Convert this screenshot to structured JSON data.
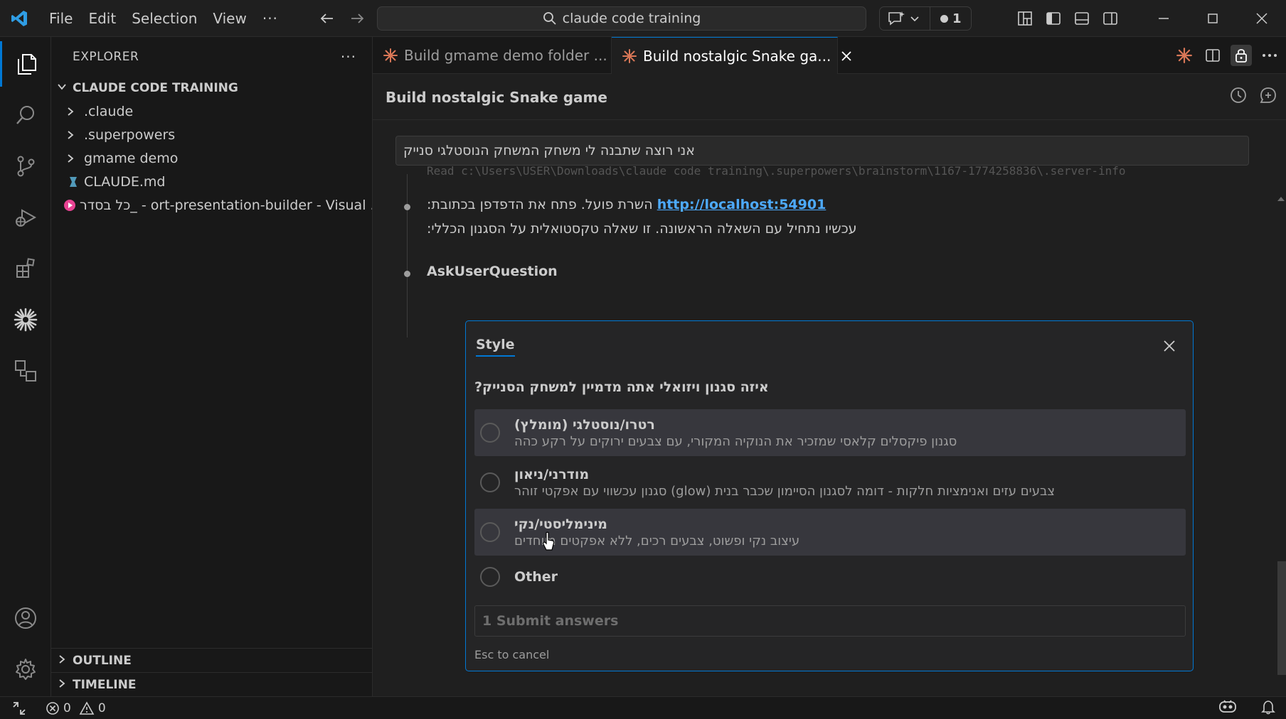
{
  "titlebar": {
    "menu": [
      "File",
      "Edit",
      "Selection",
      "View"
    ],
    "more": "···",
    "search_text": "claude code training",
    "chat_count": "1"
  },
  "sidebar": {
    "title": "EXPLORER",
    "more": "···",
    "root": "CLAUDE CODE TRAINING",
    "items": [
      {
        "label": ".claude",
        "kind": "folder"
      },
      {
        "label": ".superpowers",
        "kind": "folder"
      },
      {
        "label": "gmame demo",
        "kind": "folder"
      },
      {
        "label": "CLAUDE.md",
        "kind": "file"
      },
      {
        "label": "כל בסדר_ - ort-presentation-builder - Visual ...",
        "kind": "link"
      }
    ],
    "outline": "OUTLINE",
    "timeline": "TIMELINE"
  },
  "tabs": [
    {
      "label": "Build gmame demo folder ...",
      "active": false
    },
    {
      "label": "Build nostalgic Snake ga...",
      "active": true
    }
  ],
  "chat": {
    "title": "Build nostalgic Snake game",
    "prompt": "אני רוצה שתבנה לי משחק המשחק הנוסטלגי סנייק",
    "faded_line": "Read  c:\\Users\\USER\\Downloads\\claude code training\\.superpowers\\brainstorm\\1167-1774258836\\.server-info",
    "server_line_prefix": "השרת פועל. פתח את הדפדפן בכתובת:",
    "server_link": "http://localhost:54901",
    "server_line_2": "עכשיו נתחיל עם השאלה הראשונה. זו שאלה טקסטואלית על הסגנון הכללי:",
    "tool": "AskUserQuestion"
  },
  "dialog": {
    "tab": "Style",
    "question": "איזה סגנון ויזואלי אתה מדמיין למשחק הסנייק?",
    "options": [
      {
        "label": "רטרו/נוסטלגי (מומלץ)",
        "desc": "סגנון פיקסלים קלאסי שמזכיר את הנוקיה המקורי, עם צבעים ירוקים על רקע כהה"
      },
      {
        "label": "מודרני/ניאון",
        "desc": "צבעים עזים ואנימציות חלקות - דומה לסגנון הסיימון שכבר בנית (glow) סגנון עכשווי עם אפקטי זוהר"
      },
      {
        "label": "מינימליסטי/נקי",
        "desc": "עיצוב נקי ופשוט, צבעים רכים, ללא אפקטים מיוחדים"
      },
      {
        "label": "Other",
        "desc": ""
      }
    ],
    "submit": "1  Submit answers",
    "esc_hint": "Esc to cancel"
  },
  "status": {
    "errors": "0",
    "warnings": "0"
  },
  "colors": {
    "accent": "#0078d4",
    "link": "#4daafc",
    "claude": "#d97757"
  }
}
